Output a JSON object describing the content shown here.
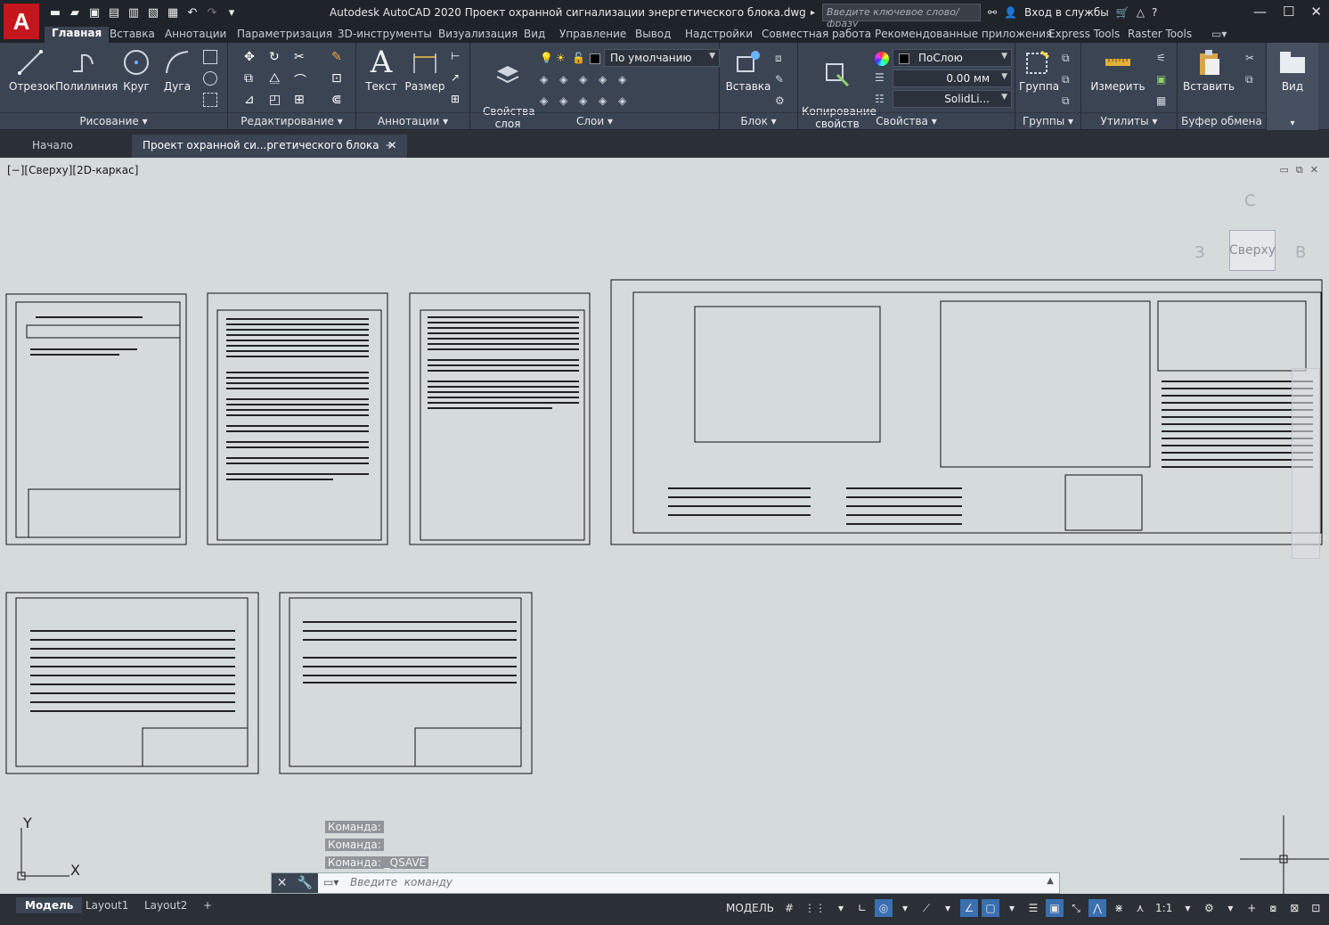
{
  "window": {
    "app_logo": "A",
    "title": "Autodesk AutoCAD 2020   Проект охранной сигнализации энергетического блока.dwg",
    "search_placeholder": "Введите ключевое слово/фразу",
    "signin": "Вход в службы",
    "win_minimize": "—",
    "win_maximize": "☐",
    "win_close": "✕"
  },
  "ribbon_tabs": [
    "Главная",
    "Вставка",
    "Аннотации",
    "Параметризация",
    "3D-инструменты",
    "Визуализация",
    "Вид",
    "Управление",
    "Вывод",
    "Надстройки",
    "Совместная работа",
    "Рекомендованные приложения",
    "Express Tools",
    "Raster Tools"
  ],
  "ribbon": {
    "draw": {
      "title": "Рисование",
      "line": "Отрезок",
      "polyline": "Полилиния",
      "circle": "Круг",
      "arc": "Дуга"
    },
    "modify": {
      "title": "Редактирование"
    },
    "annotation": {
      "title": "Аннотации",
      "text": "Текст",
      "dimension": "Размер"
    },
    "layers": {
      "title": "Слои",
      "props": "Свойства\nслоя",
      "layer_combo": "По умолчанию"
    },
    "block": {
      "title": "Блок",
      "insert": "Вставка"
    },
    "properties": {
      "title": "Свойства",
      "match": "Копирование\nсвойств",
      "color_combo": "ПоСлою",
      "lineweight_combo": "0.00 мм",
      "linetype_combo": "SolidLi..."
    },
    "groups": {
      "title": "Группы",
      "group": "Группа"
    },
    "utilities": {
      "title": "Утилиты",
      "measure": "Измерить"
    },
    "clipboard": {
      "title": "Буфер обмена",
      "paste": "Вставить"
    },
    "view": {
      "title": "Вид"
    }
  },
  "doc_tabs": {
    "start": "Начало",
    "active": "Проект охранной си...ргетического блока",
    "close": "✕",
    "add": "+"
  },
  "viewport": {
    "label": "[−][Сверху][2D-каркас]",
    "viewcube_top": "Сверху",
    "viewcube_n": "С",
    "viewcube_w": "З",
    "viewcube_e": "В",
    "ucs_x": "X",
    "ucs_y": "Y"
  },
  "command_history": [
    "Команда:",
    "Команда:",
    "Команда:  _QSAVE"
  ],
  "command_placeholder": "Введите  команду",
  "layout_tabs": [
    "Модель",
    "Layout1",
    "Layout2"
  ],
  "layout_add": "+",
  "status": {
    "model": "МОДЕЛЬ",
    "scale": "1:1"
  }
}
